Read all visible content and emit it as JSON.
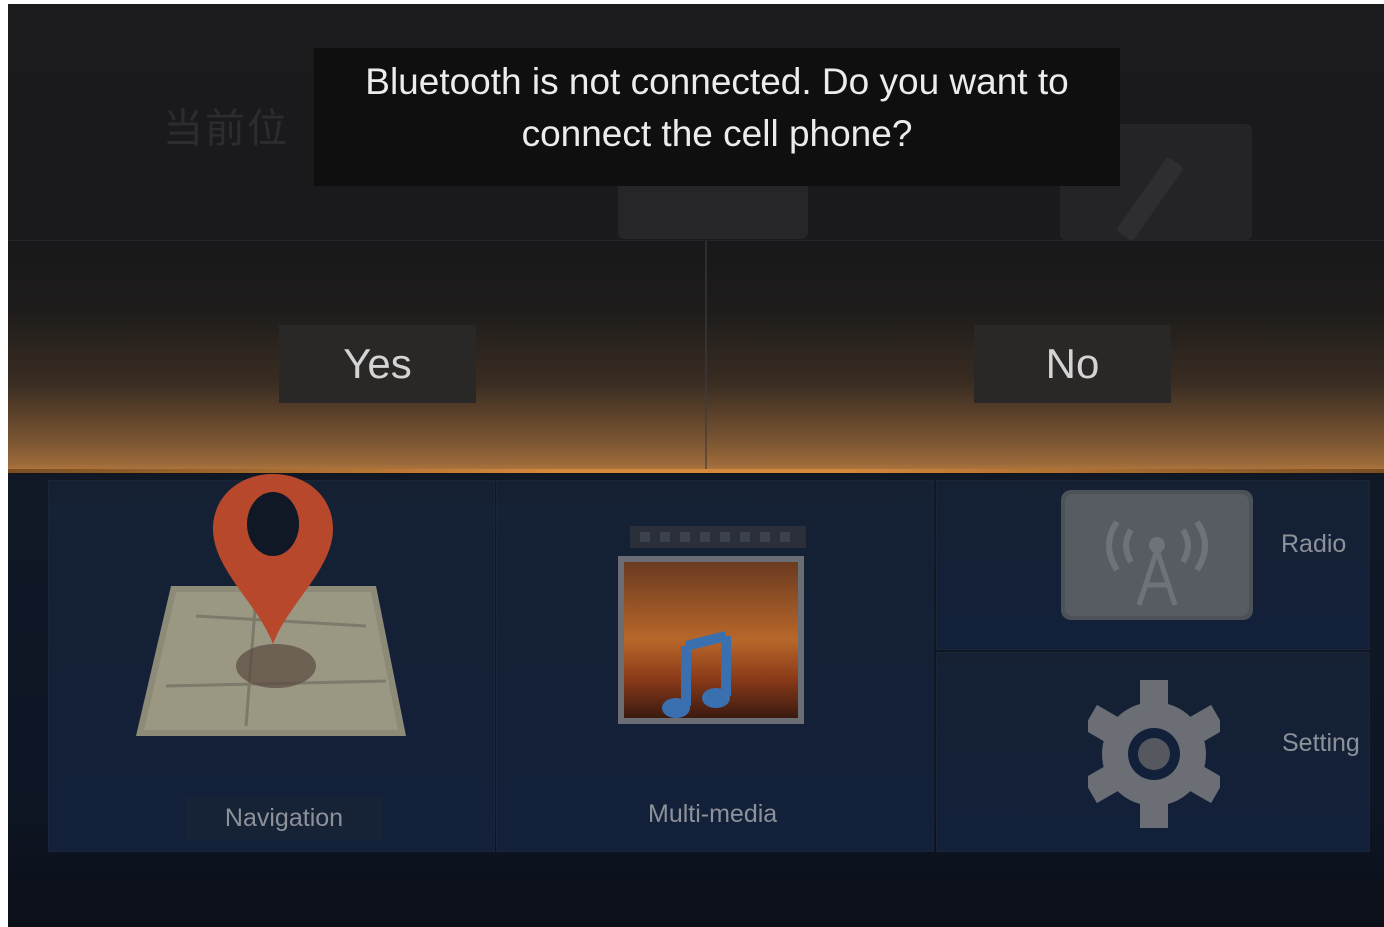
{
  "dialog": {
    "message": "Bluetooth is not connected. Do you want to connect the cell phone?",
    "yes_label": "Yes",
    "no_label": "No"
  },
  "home": {
    "location_text": "当前位",
    "tiles": [
      {
        "label": "Navigation",
        "icon": "map-pin-icon"
      },
      {
        "label": "Multi-media",
        "icon": "media-icon"
      },
      {
        "label": "Radio",
        "icon": "radio-icon"
      },
      {
        "label": "Setting",
        "icon": "gear-icon"
      }
    ]
  },
  "colors": {
    "accent_orange": "#d6893c",
    "pin_red": "#c8472a",
    "panel_blue": "#152133",
    "dialog_bg": "#0f0f10"
  }
}
